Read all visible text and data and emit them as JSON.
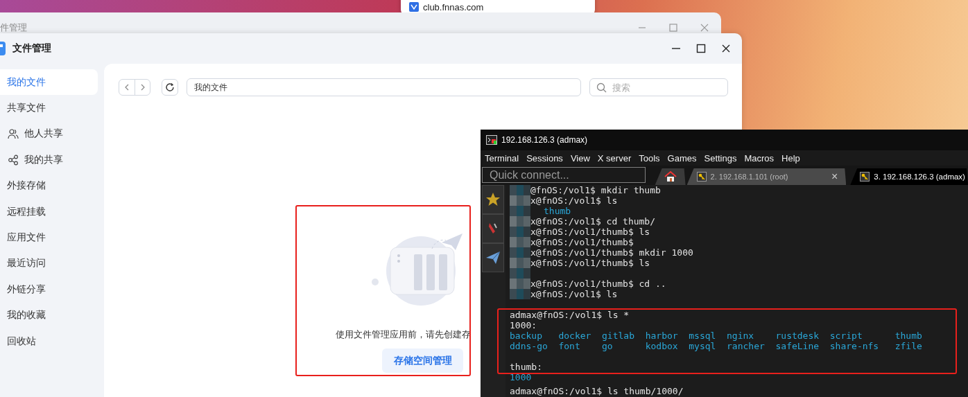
{
  "desktop_popup": {
    "url": "club.fnnas.com"
  },
  "back_window": {
    "title": "件管理"
  },
  "window": {
    "title": "文件管理"
  },
  "sidebar": {
    "items": [
      {
        "label": "我的文件",
        "selected": true
      },
      {
        "label": "共享文件",
        "selected": false,
        "children": [
          {
            "label": "他人共享",
            "selected": false
          },
          {
            "label": "我的共享",
            "selected": false
          }
        ]
      },
      {
        "label": "外接存储",
        "selected": false
      },
      {
        "label": "远程挂载",
        "selected": false
      },
      {
        "label": "应用文件",
        "selected": false
      },
      {
        "label": "最近访问",
        "selected": false
      },
      {
        "label": "外链分享",
        "selected": false
      },
      {
        "label": "我的收藏",
        "selected": false
      },
      {
        "label": "回收站",
        "selected": false
      }
    ]
  },
  "toolbar": {
    "path": "我的文件",
    "search": {
      "placeholder": "搜索"
    }
  },
  "empty_state": {
    "message": "使用文件管理应用前，请先创建存",
    "button": "存储空间管理"
  },
  "terminal": {
    "title": "192.168.126.3 (admax)",
    "menu": [
      "Terminal",
      "Sessions",
      "View",
      "X server",
      "Tools",
      "Games",
      "Settings",
      "Macros",
      "Help"
    ],
    "quick_connect": {
      "placeholder": "Quick connect..."
    },
    "tabs": [
      {
        "kind": "home",
        "selected": false
      },
      {
        "kind": "session",
        "label": "2. 192.168.1.101 (root)",
        "selected": false,
        "close": "×"
      },
      {
        "kind": "session",
        "label": "3. 192.168.126.3 (admax)",
        "selected": true
      }
    ],
    "lines": [
      {
        "kind": "text",
        "text": "@fnOS:/vol1$ mkdir thumb",
        "masked": true
      },
      {
        "kind": "text",
        "text": "x@fnOS:/vol1$ ls",
        "masked": true
      },
      {
        "kind": "files",
        "rows": [
          [
            "thumb"
          ]
        ],
        "masked": true
      },
      {
        "kind": "text",
        "text": "x@fnOS:/vol1$ cd thumb/",
        "masked": true
      },
      {
        "kind": "text",
        "text": "x@fnOS:/vol1/thumb$ ls",
        "masked": true
      },
      {
        "kind": "text",
        "text": "x@fnOS:/vol1/thumb$",
        "masked": true
      },
      {
        "kind": "text",
        "text": "x@fnOS:/vol1/thumb$ mkdir 1000",
        "masked": true
      },
      {
        "kind": "text",
        "text": "x@fnOS:/vol1/thumb$ ls",
        "masked": true
      },
      {
        "kind": "blank",
        "masked": true
      },
      {
        "kind": "text",
        "text": "x@fnOS:/vol1/thumb$ cd ..",
        "masked": true
      },
      {
        "kind": "text",
        "text": "x@fnOS:/vol1$ ls",
        "masked": true
      },
      {
        "kind": "blank",
        "masked": false
      },
      {
        "kind": "text",
        "text": "admax@fnOS:/vol1$ ls *",
        "masked": false
      },
      {
        "kind": "text",
        "text": "1000:",
        "masked": false
      },
      {
        "kind": "files",
        "rows": [
          [
            "backup",
            "docker",
            "gitlab",
            "harbor",
            "mssql",
            "nginx",
            "rustdesk",
            "script",
            "thumb"
          ],
          [
            "ddns-go",
            "font",
            "go",
            "kodbox",
            "mysql",
            "rancher",
            "safeLine",
            "share-nfs",
            "zfile"
          ]
        ],
        "masked": false
      },
      {
        "kind": "blank",
        "masked": false
      },
      {
        "kind": "text",
        "text": "thumb:",
        "masked": false
      },
      {
        "kind": "files",
        "rows": [
          [
            "1000"
          ]
        ],
        "masked": false
      },
      {
        "kind": "text",
        "text": "admax@fnOS:/vol1$ ls thumb/1000/",
        "masked": false
      }
    ]
  }
}
